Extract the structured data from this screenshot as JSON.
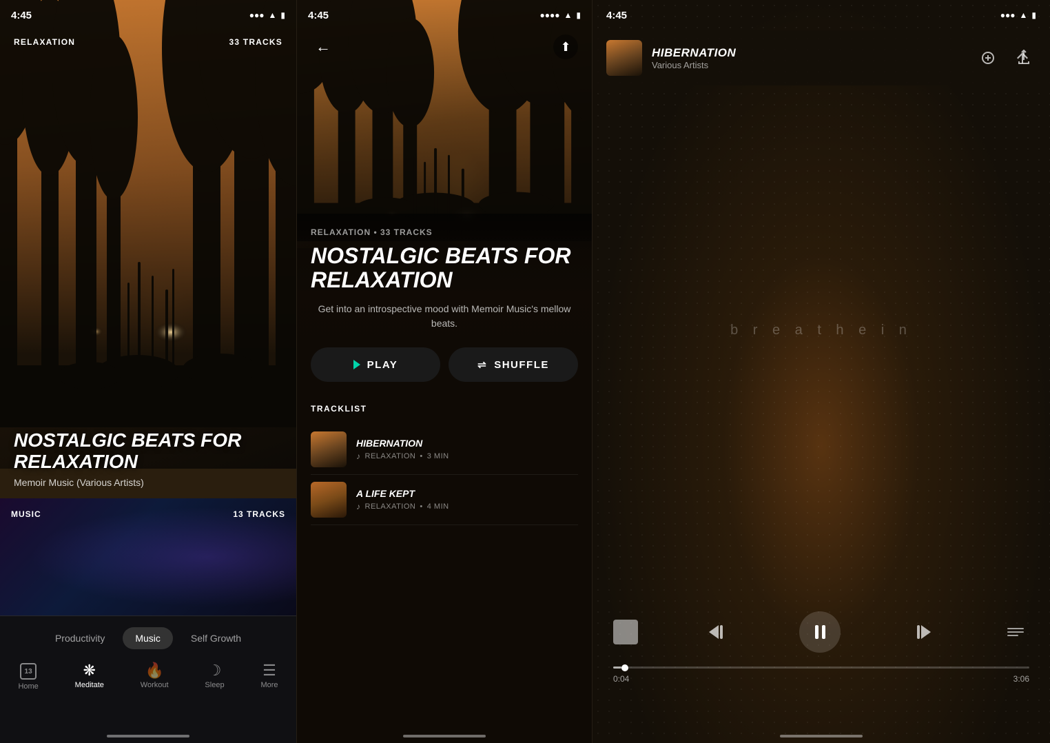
{
  "panel1": {
    "status_time": "4:45",
    "overlay_category": "RELAXATION",
    "overlay_tracks": "33 TRACKS",
    "playlist_title": "NOSTALGIC BEATS FOR RELAXATION",
    "playlist_author": "Memoir Music (Various Artists)",
    "music_label": "MUSIC",
    "music_tracks": "13 TRACKS",
    "categories": [
      "Productivity",
      "Music",
      "Self Growth"
    ],
    "active_category": "Music",
    "tabs": [
      {
        "id": "home",
        "label": "Home",
        "icon": "home"
      },
      {
        "id": "meditate",
        "label": "Meditate",
        "icon": "meditate",
        "active": true
      },
      {
        "id": "workout",
        "label": "Workout",
        "icon": "workout"
      },
      {
        "id": "sleep",
        "label": "Sleep",
        "icon": "sleep"
      },
      {
        "id": "more",
        "label": "More",
        "icon": "more"
      }
    ]
  },
  "panel2": {
    "status_time": "4:45",
    "playlist_meta": "RELAXATION • 33 TRACKS",
    "playlist_title": "NOSTALGIC BEATS FOR RELAXATION",
    "playlist_desc": "Get into an introspective mood with Memoir Music's mellow beats.",
    "play_label": "PLAY",
    "shuffle_label": "SHUFFLE",
    "tracklist_header": "TRACKLIST",
    "tracks": [
      {
        "title": "HIBERNATION",
        "category": "RELAXATION",
        "duration": "3 MIN",
        "thumb_style": "1"
      },
      {
        "title": "A LIFE KEPT",
        "category": "RELAXATION",
        "duration": "4 MIN",
        "thumb_style": "2"
      }
    ]
  },
  "panel3": {
    "status_time": "4:45",
    "track_title": "HIBERNATION",
    "track_artist": "Various Artists",
    "breathe_text": "b r e a t h e  i n",
    "current_time": "0:04",
    "total_time": "3:06",
    "progress_pct": 2
  }
}
